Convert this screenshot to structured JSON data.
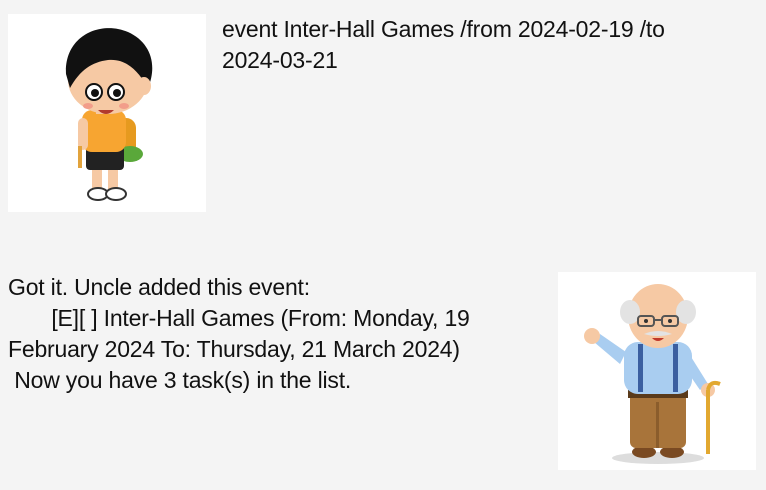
{
  "conversation": {
    "user_message": {
      "avatar_icon": "boy-with-backpack-icon",
      "text": "event Inter-Hall Games /from 2024-02-19 /to\n2024-03-21"
    },
    "bot_message": {
      "avatar_icon": "grandpa-with-cane-icon",
      "text": "Got it. Uncle added this event:\n       [E][ ] Inter-Hall Games (From: Monday, 19\nFebruary 2024 To: Thursday, 21 March 2024)\n Now you have 3 task(s) in the list."
    }
  },
  "colors": {
    "background": "#f4f4f4",
    "avatar_background": "#ffffff",
    "text": "#111111"
  }
}
